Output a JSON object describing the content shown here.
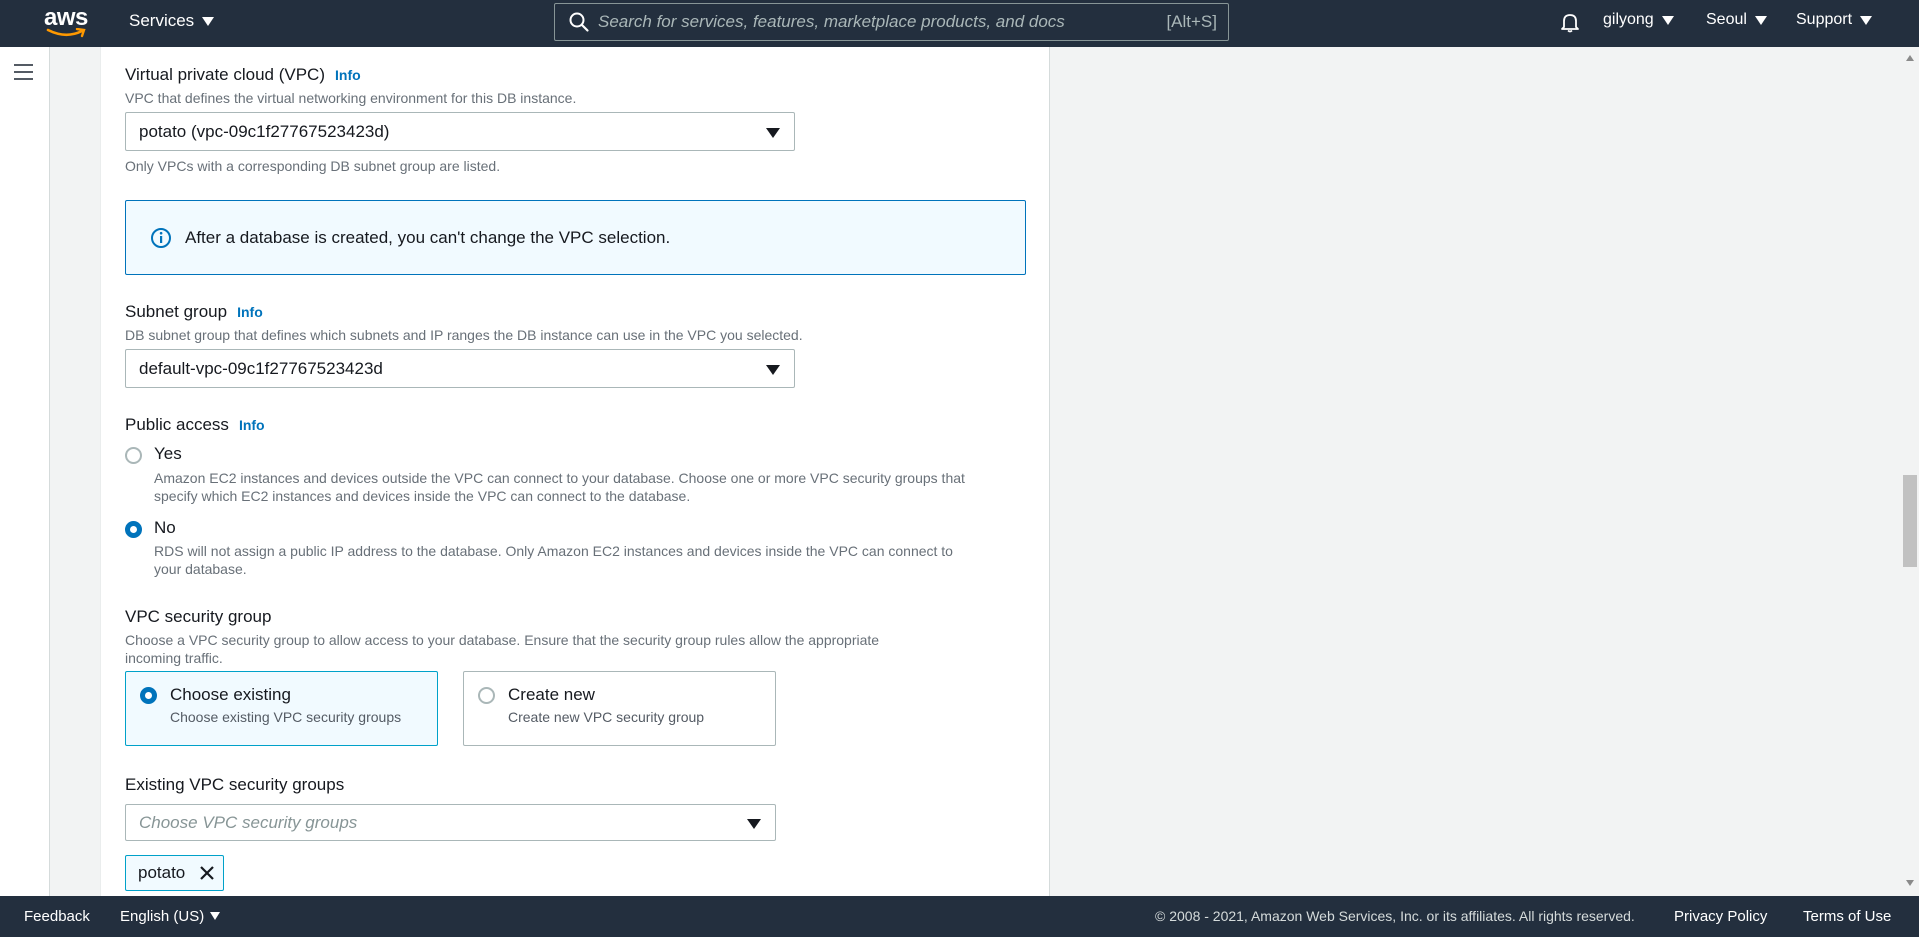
{
  "header": {
    "logo_text": "aws",
    "services_label": "Services",
    "search_placeholder": "Search for services, features, marketplace products, and docs",
    "search_shortcut": "[Alt+S]",
    "user": "gilyong",
    "region": "Seoul",
    "support": "Support"
  },
  "vpc": {
    "label": "Virtual private cloud (VPC)",
    "info": "Info",
    "description": "VPC that defines the virtual networking environment for this DB instance.",
    "selected": "potato (vpc-09c1f27767523423d)",
    "note": "Only VPCs with a corresponding DB subnet group are listed.",
    "alert": "After a database is created, you can't change the VPC selection."
  },
  "subnet": {
    "label": "Subnet group",
    "info": "Info",
    "description": "DB subnet group that defines which subnets and IP ranges the DB instance can use in the VPC you selected.",
    "selected": "default-vpc-09c1f27767523423d"
  },
  "public_access": {
    "label": "Public access",
    "info": "Info",
    "yes_label": "Yes",
    "yes_desc_1": "Amazon EC2 instances and devices outside the VPC can connect to your database. Choose one or more VPC security groups that",
    "yes_desc_2": "specify which EC2 instances and devices inside the VPC can connect to the database.",
    "no_label": "No",
    "no_desc_1": "RDS will not assign a public IP address to the database. Only Amazon EC2 instances and devices inside the VPC can connect to",
    "no_desc_2": "your database.",
    "selected": "No"
  },
  "security_group": {
    "label": "VPC security group",
    "desc_1": "Choose a VPC security group to allow access to your database. Ensure that the security group rules allow the appropriate",
    "desc_2": "incoming traffic.",
    "existing_title": "Choose existing",
    "existing_desc": "Choose existing VPC security groups",
    "new_title": "Create new",
    "new_desc": "Create new VPC security group",
    "selected": "Choose existing"
  },
  "existing_groups": {
    "label": "Existing VPC security groups",
    "placeholder": "Choose VPC security groups",
    "tokens": [
      "potato"
    ]
  },
  "footer": {
    "feedback": "Feedback",
    "language": "English (US)",
    "copyright": "© 2008 - 2021, Amazon Web Services, Inc. or its affiliates. All rights reserved.",
    "privacy": "Privacy Policy",
    "terms": "Terms of Use"
  },
  "colors": {
    "nav_bg": "#232f3e",
    "link": "#0073bb",
    "selected_border": "#00a1c9",
    "selected_bg": "#f1faff"
  }
}
